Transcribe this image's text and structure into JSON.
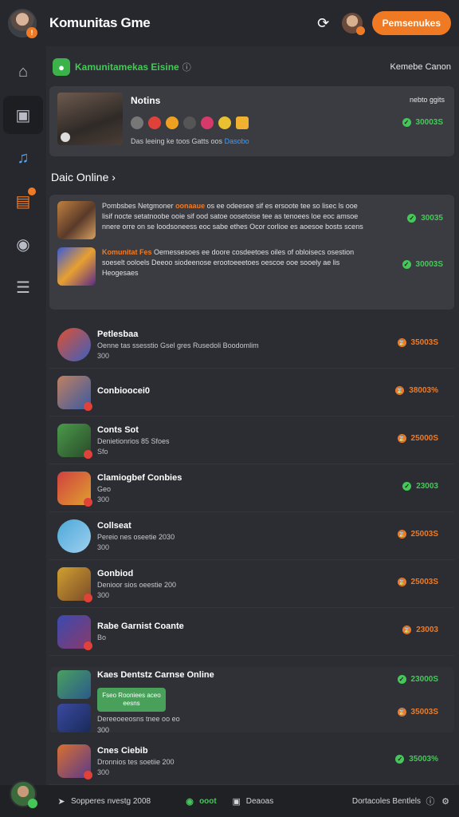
{
  "header": {
    "title": "Komunitas Gme",
    "cta_label": "Pemsenukes"
  },
  "sidebar": {
    "items": [
      {
        "icon": "home-icon"
      },
      {
        "icon": "stop-icon"
      },
      {
        "icon": "music-icon"
      },
      {
        "icon": "chat-icon",
        "badge": true
      },
      {
        "icon": "shirt-icon"
      },
      {
        "icon": "stack-icon"
      }
    ]
  },
  "section": {
    "title": "Kamunitamekas Eisine",
    "info": "ⓘ",
    "right_label": "Kemebe Canon"
  },
  "feature": {
    "title": "Notins",
    "meta": "nebto ggits",
    "subtitle": "Das leeing ke toos Gatts oos",
    "subtitle_link": "Dasobo",
    "score": "30003S"
  },
  "online": {
    "heading": "Daic Online ›",
    "items": [
      {
        "lead": "Pombsbes Netgmoner",
        "highlight": "oonaaue",
        "text": "os ee odeesee sif es ersoote tee so lisec ls ooe lisif nocte setatnoobe ooie sif ood satoe oosetoise tee as tenoees loe eoc amsoe nnere orre on se loodsoneess eoc sabe ethes Ocor corlioe es aoesoe bosts scens",
        "score": "30035"
      },
      {
        "lead": "",
        "highlight": "Komunitat Fes",
        "text": "Oemessesoes ee doore cosdeetoes oiles of obloisecs osestion soeselt ooloels Deeoo siodeenose erootoeeetoes oescoe ooe sooely ae lis Heogesaes",
        "score": "30003S"
      }
    ]
  },
  "list": [
    {
      "name": "Petlesbaa",
      "desc": "Oenne tas ssesstio Gsel  gres  Rusedoli Boodomlim",
      "extra": "300",
      "score": "35003S",
      "color": "orange"
    },
    {
      "name": "Conbioocei0",
      "desc": "",
      "extra": "",
      "score": "38003%",
      "color": "orange"
    },
    {
      "name": "Conts Sot",
      "desc": "Denietionrios 85 Sfoes",
      "extra": "Sfo",
      "score": "25000S",
      "color": "orange"
    },
    {
      "name": "Clamiogbef Conbies",
      "desc": "Geo",
      "extra": "300",
      "score": "23003",
      "color": "green"
    },
    {
      "name": "Collseat",
      "desc": "Pereio nes oseetie 2030",
      "extra": "300",
      "score": "25003S",
      "color": "orange"
    },
    {
      "name": "Gonbiod",
      "desc": "Denioor sios oeestie 200",
      "extra": "300",
      "score": "25003S",
      "color": "orange"
    },
    {
      "name": "Rabe Garnist Coante",
      "desc": "",
      "extra": "Bo",
      "score": "23003",
      "color": "orange"
    }
  ],
  "bottom_card": {
    "name": "Kaes Dentstz Carnse Online",
    "tag": "Fseo Rooniees aceo eesns",
    "desc": "Dereeoeeosns tnee oo eo",
    "extra": "300",
    "score1": "23000S",
    "score2": "35003S"
  },
  "last_item": {
    "name": "Cnes Ciebib",
    "desc": "Dronnios tes soetiie 200",
    "extra": "300",
    "score": "35003%"
  },
  "footer": {
    "left": "Sopperes nvestg 2008",
    "mid1": "ooot",
    "mid2": "Deaoas",
    "right": "Dortacoles Bentlels"
  },
  "colors": {
    "accent": "#f07a24",
    "positive": "#46c759",
    "bg": "#2b2d33",
    "card": "#3a3c42"
  }
}
